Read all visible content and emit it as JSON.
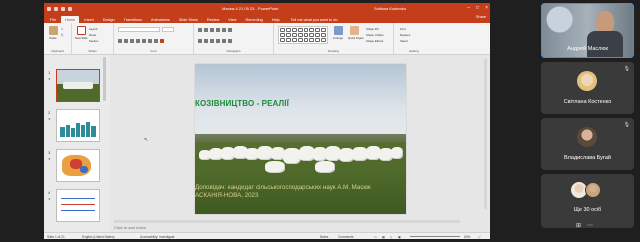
{
  "powerpoint": {
    "title": "Масюк 4 21 05 23 - PowerPoint",
    "user": "Svitlana Kostenko",
    "share": "Share",
    "tabs": [
      "File",
      "Home",
      "Insert",
      "Design",
      "Transitions",
      "Animations",
      "Slide Show",
      "Review",
      "View",
      "Recording",
      "Help"
    ],
    "tell_me": "Tell me what you want to do",
    "ribbon": {
      "paste": "Paste",
      "new_slide": "New Slide",
      "layout": "Layout",
      "reset": "Reset",
      "section": "Section",
      "arrange": "Arrange",
      "quick_styles": "Quick Styles",
      "shape_fill": "Shape Fill",
      "shape_outline": "Shape Outline",
      "shape_effects": "Shape Effects",
      "find": "Find",
      "replace": "Replace",
      "select": "Select",
      "groups": [
        "Clipboard",
        "Slides",
        "Font",
        "Paragraph",
        "Drawing",
        "Editing"
      ]
    },
    "thumbnails": [
      {
        "num": "1"
      },
      {
        "num": "2"
      },
      {
        "num": "3"
      },
      {
        "num": "4"
      }
    ],
    "slide": {
      "title": "КОЗІВНИЦТВО - РЕАЛІЇ",
      "subtitle_line1": "Доповідач: кандидат сільськогосподарських наук А.М. Масюк",
      "subtitle_line2": "АСКАНІЯ-НОВА, 2023"
    },
    "notes_placeholder": "Click to add notes",
    "status": {
      "slide_counter": "Slide 1 of 21",
      "language": "English (United States)",
      "accessibility": "Accessibility: Investigate",
      "notes": "Notes",
      "comments": "Comments",
      "zoom": "63%"
    }
  },
  "meeting": {
    "participants": [
      {
        "name": "Андрей Маслюк",
        "speaking": true
      },
      {
        "name": "Світлана Костенко"
      },
      {
        "name": "Владислава Бугай"
      }
    ],
    "more_label": "Ще 30 осіб"
  }
}
